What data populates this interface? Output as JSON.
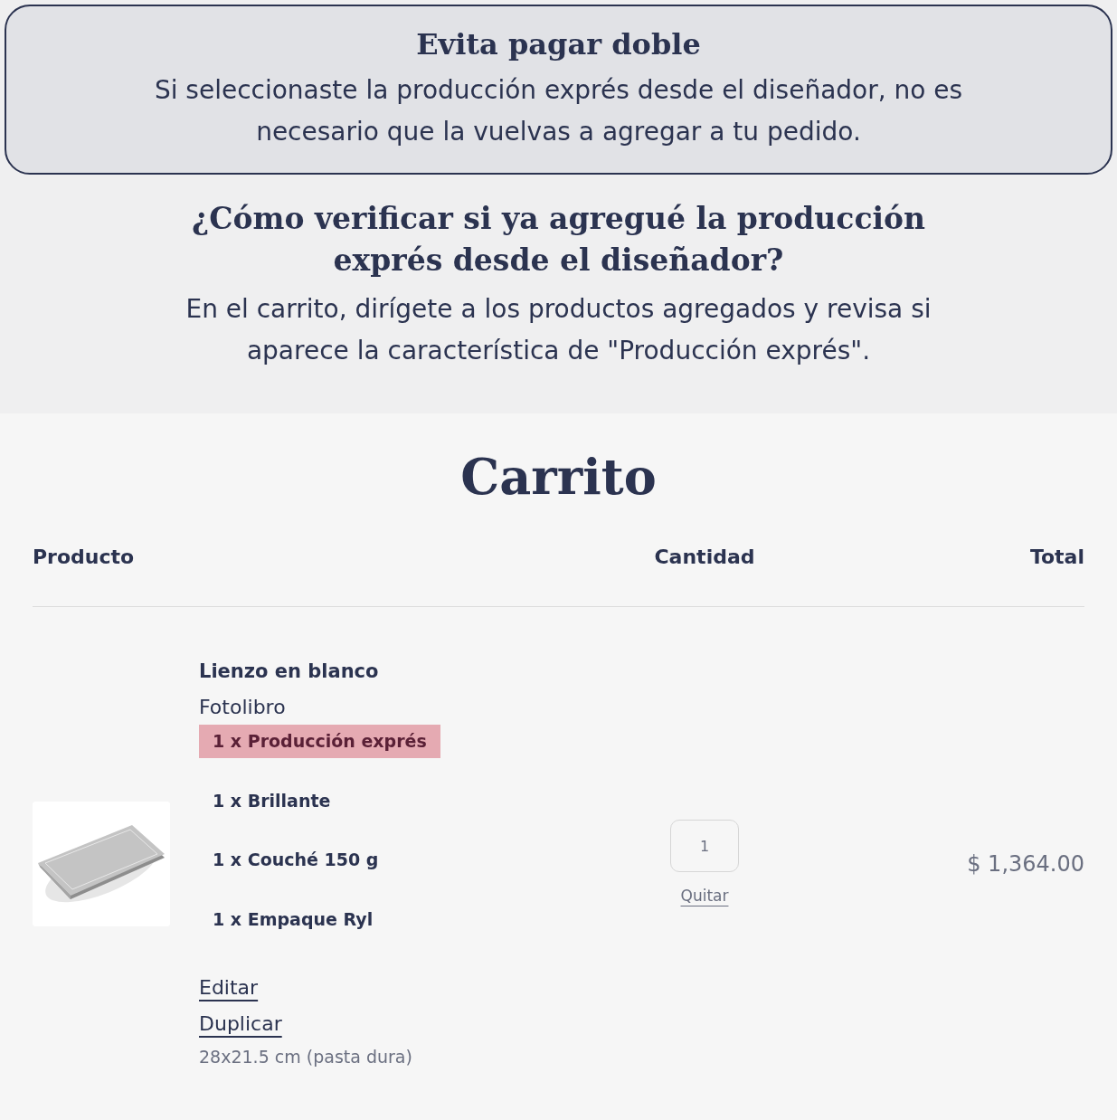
{
  "notice": {
    "title": "Evita pagar doble",
    "body": "Si seleccionaste la producción exprés desde el diseñador, no es necesario que la vuelvas a agregar a tu pedido."
  },
  "help": {
    "question": "¿Cómo verificar si ya agregué la producción exprés desde el diseñador?",
    "answer": "En el carrito, dirígete a los productos agregados y revisa si aparece la característica de \"Producción exprés\"."
  },
  "cart": {
    "title": "Carrito",
    "columns": [
      "Producto",
      "Cantidad",
      "Total"
    ],
    "items": [
      {
        "image": {
          "kind": "picture"
        },
        "name": "Lienzo en blanco",
        "type": "Fotolibro",
        "options": [
          {
            "text": "1 x Producción exprés",
            "highlighted": true
          },
          {
            "text": "1 x Brillante",
            "highlighted": false
          },
          {
            "text": "1 x Couché 150 g",
            "highlighted": false
          },
          {
            "text": "1 x Empaque Ryl",
            "highlighted": false
          }
        ],
        "links": [
          "Editar",
          "Duplicar"
        ],
        "size": "28x21.5 cm (pasta dura)",
        "quantity": "1",
        "remove": "Quitar",
        "total": "$ 1,364.00"
      }
    ]
  }
}
